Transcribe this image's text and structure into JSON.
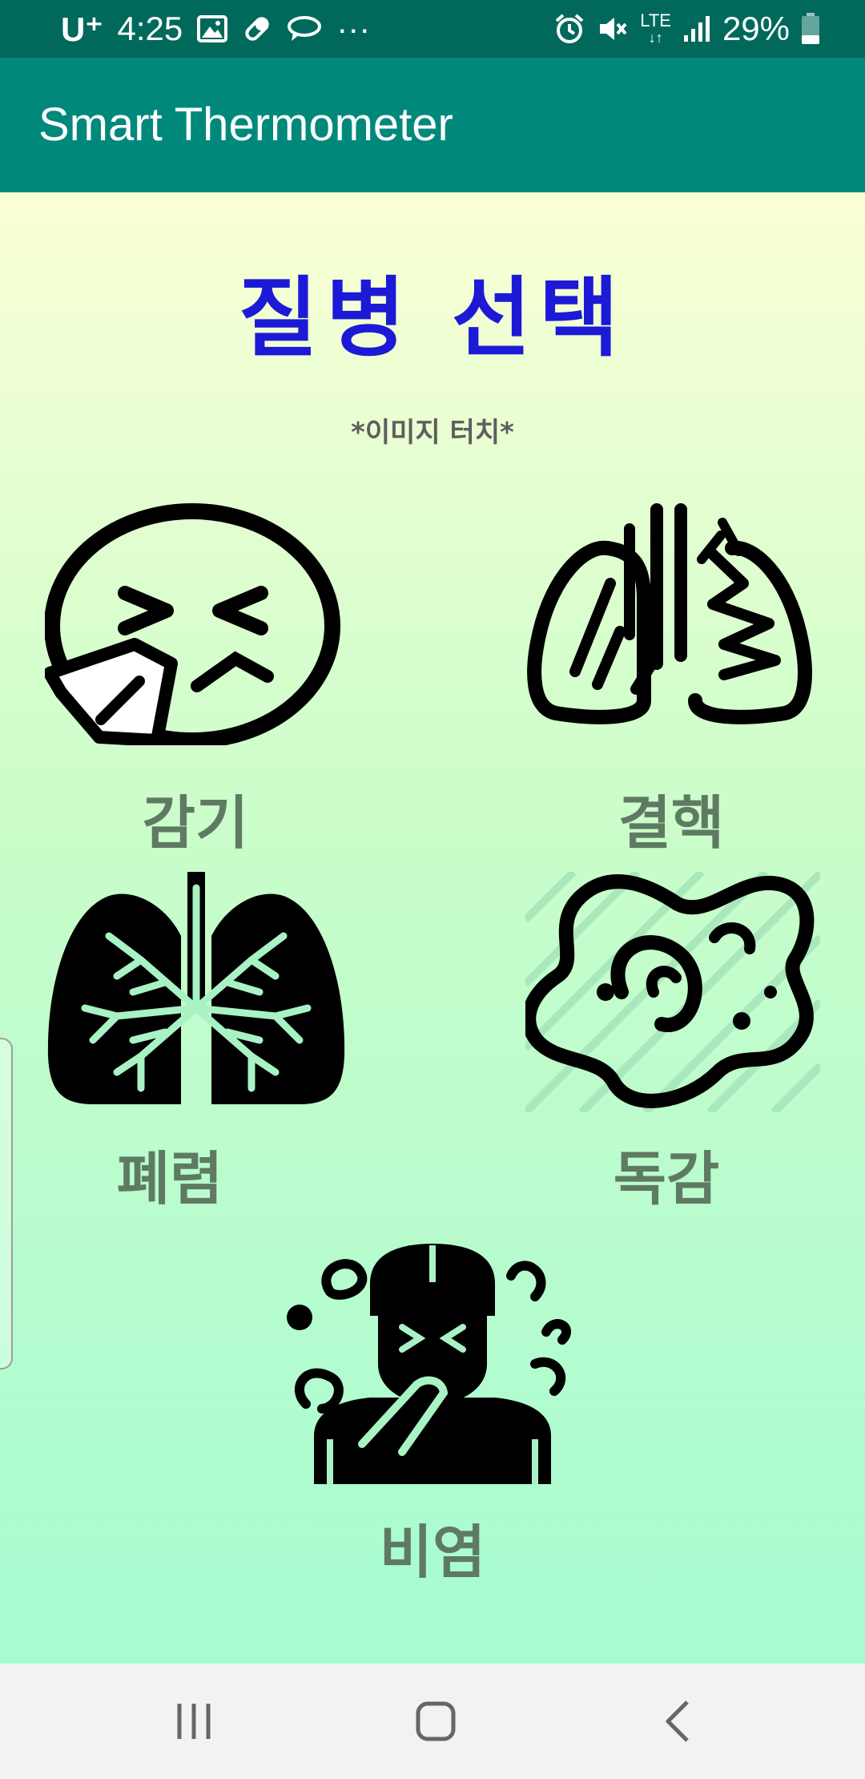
{
  "status_bar": {
    "carrier": "U⁺",
    "time": "4:25",
    "more": "···",
    "network": "LTE",
    "battery": "29%",
    "icons": [
      "image-icon",
      "pill-icon",
      "chat-icon",
      "alarm-icon",
      "mute-icon",
      "lte-icon",
      "signal-icon",
      "battery-icon"
    ]
  },
  "app_bar": {
    "title": "Smart Thermometer"
  },
  "main": {
    "title": "질병 선택",
    "hint": "*이미지 터치*",
    "diseases": [
      {
        "label": "감기",
        "icon": "sneezing-face-icon"
      },
      {
        "label": "결핵",
        "icon": "damaged-lungs-icon"
      },
      {
        "label": "폐렴",
        "icon": "lungs-icon"
      },
      {
        "label": "독감",
        "icon": "virus-icon"
      },
      {
        "label": "비염",
        "icon": "sneezing-person-icon"
      }
    ]
  },
  "nav_bar": {
    "buttons": [
      "recent-apps-icon",
      "home-icon",
      "back-icon"
    ]
  },
  "colors": {
    "status_bar": "#00695c",
    "app_bar": "#00897b",
    "title": "#1c1ad6",
    "label": "#5f7a62",
    "hint": "#5e5e5e"
  }
}
